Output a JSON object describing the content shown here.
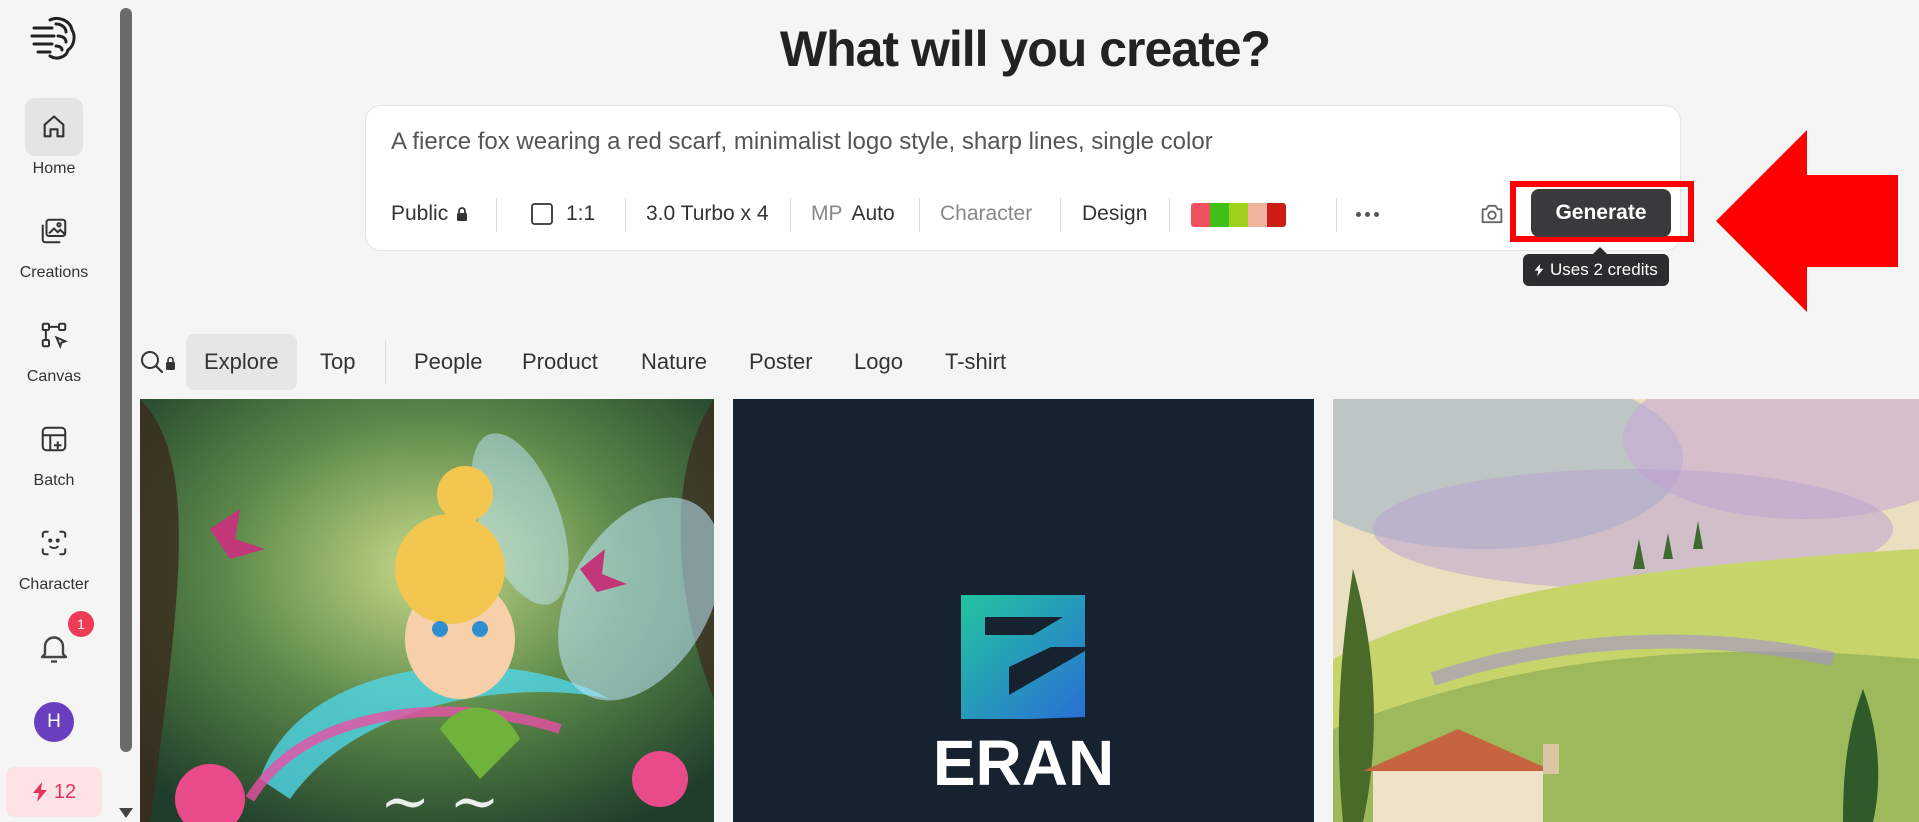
{
  "sidebar": {
    "logo_icon": "brain-circuit-logo",
    "items": [
      {
        "label": "Home",
        "icon": "home-icon",
        "active": true
      },
      {
        "label": "Creations",
        "icon": "image-gallery-icon"
      },
      {
        "label": "Canvas",
        "icon": "canvas-icon"
      },
      {
        "label": "Batch",
        "icon": "batch-icon"
      },
      {
        "label": "Character",
        "icon": "character-face-icon"
      }
    ],
    "notifications": {
      "icon": "bell-icon",
      "count": "1"
    },
    "avatar_initial": "H",
    "credits": {
      "icon": "lightning-icon",
      "value": "12"
    }
  },
  "header": {
    "title": "What will you create?"
  },
  "prompt": {
    "text": "A fierce fox wearing a red scarf, minimalist logo style, sharp lines, single color",
    "visibility": "Public",
    "aspect_ratio": "1:1",
    "model": "3.0 Turbo x 4",
    "mp_label": "MP",
    "mp_value": "Auto",
    "character": "Character",
    "design": "Design",
    "palette": [
      "#f0505f",
      "#3fc016",
      "#9fd21a",
      "#f0b59e",
      "#cc1d17"
    ],
    "generate_label": "Generate",
    "tooltip": "Uses 2 credits"
  },
  "annotation": {
    "color": "#ff0000"
  },
  "tabs": [
    "Explore",
    "Top",
    "People",
    "Product",
    "Nature",
    "Poster",
    "Logo",
    "T-shirt"
  ],
  "gallery": [
    {
      "name": "fairy-illustration"
    },
    {
      "name": "eran-logo",
      "logo_text": "ERAN"
    },
    {
      "name": "watercolor-landscape"
    }
  ]
}
